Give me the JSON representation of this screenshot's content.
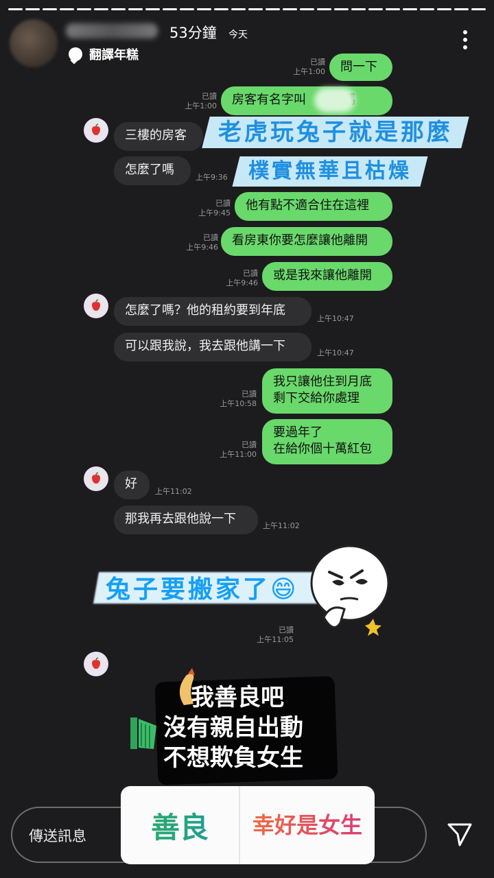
{
  "header": {
    "time_ago": "53分鐘",
    "today": "今天",
    "translate_label": "翻譯年糕"
  },
  "messages": [
    {
      "side": "me",
      "text": "問一下",
      "read": "已讀",
      "time": "上午1:00"
    },
    {
      "side": "me",
      "text": "房客有名字叫　　的嗎",
      "read": "已讀",
      "time": "上午1:00"
    },
    {
      "side": "them",
      "text": "三樓的房客"
    },
    {
      "side": "them",
      "text": "怎麼了嗎",
      "time": "上午9:36"
    },
    {
      "side": "me",
      "text": "他有點不適合住在這裡",
      "read": "已讀",
      "time": "上午9:45"
    },
    {
      "side": "me",
      "text": "看房東你要怎麼讓他離開",
      "read": "已讀",
      "time": "上午9:46"
    },
    {
      "side": "me",
      "text": "或是我來讓他離開",
      "read": "已讀",
      "time": "上午9:46"
    },
    {
      "side": "them",
      "text": "怎麼了嗎？他的租約要到年底",
      "time": "上午10:47"
    },
    {
      "side": "them",
      "text": "可以跟我說，我去跟他講一下",
      "time": "上午10:47"
    },
    {
      "side": "me",
      "text_line1": "我只讓他住到月底",
      "text_line2": "剩下交給你處理",
      "read": "已讀",
      "time": "上午10:58"
    },
    {
      "side": "me",
      "text_line1": "要過年了",
      "text_line2": "在給你個十萬紅包",
      "read": "已讀",
      "time": "上午11:00"
    },
    {
      "side": "them",
      "text": "好",
      "time": "上午11:02"
    },
    {
      "side": "them",
      "text": "那我再去跟他說一下",
      "time": "上午11:02"
    }
  ],
  "sticker_read": {
    "read": "已讀",
    "time": "上午11:05"
  },
  "overlays": {
    "banner1": "老虎玩兔子就是那麼",
    "banner2": "樸實無華且枯燥",
    "banner3": "兔子要搬家了😄",
    "note_line1": "我善良吧",
    "note_line2": "沒有親自出動",
    "note_line3": "不想欺負女生"
  },
  "poll": {
    "option_a": "善良",
    "option_b": "幸好是女生"
  },
  "footer": {
    "placeholder": "傳送訊息"
  },
  "icons": [
    "more-dots-icon",
    "translate-icon",
    "apple-avatar-icon",
    "send-icon"
  ],
  "colors": {
    "my_bubble": "#69d96b",
    "their_bubble": "#2f2f31",
    "banner_text": "#1f8fe0"
  }
}
